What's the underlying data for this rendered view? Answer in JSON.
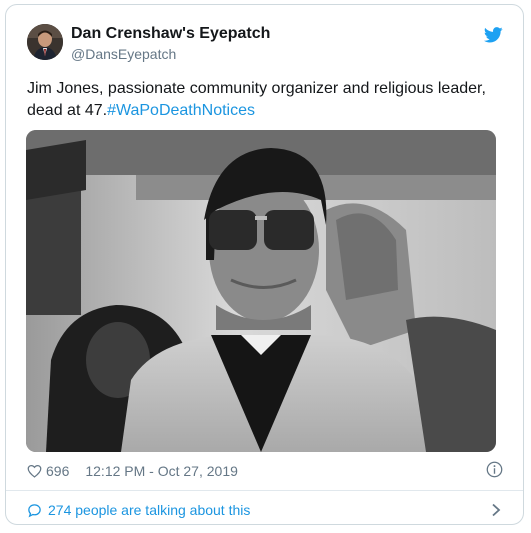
{
  "author": {
    "display_name": "Dan Crenshaw's Eyepatch",
    "handle": "@DansEyepatch"
  },
  "tweet": {
    "text": "Jim Jones, passionate community organizer and religious leader, dead at 47.",
    "hashtag": "#WaPoDeathNotices"
  },
  "footer": {
    "likes": "696",
    "timestamp": "12:12 PM - Oct 27, 2019",
    "talking": "274 people are talking about this"
  },
  "icons": {
    "brand": "twitter-bird-icon",
    "like": "heart-icon",
    "info": "info-icon",
    "conversation": "speech-bubble-icon",
    "more": "chevron-right-icon"
  },
  "colors": {
    "accent": "#1b95e0",
    "muted": "#657786",
    "text": "#14171a",
    "border": "#cfd9de"
  }
}
